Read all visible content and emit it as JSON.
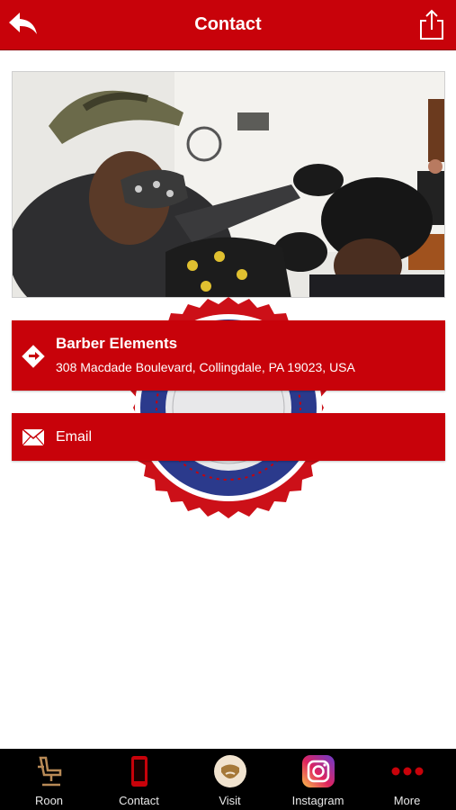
{
  "header": {
    "title": "Contact"
  },
  "location": {
    "name": "Barber Elements",
    "address": "308 Macdade Boulevard, Collingdale, PA 19023, USA"
  },
  "email": {
    "label": "Email"
  },
  "tabs": [
    {
      "label": "Roon",
      "icon": "barber-chair-icon"
    },
    {
      "label": "Contact",
      "icon": "phone-icon"
    },
    {
      "label": "Visit",
      "icon": "bearded-face-icon"
    },
    {
      "label": "Instagram",
      "icon": "instagram-icon"
    },
    {
      "label": "More",
      "icon": "more-dots-icon"
    }
  ],
  "colors": {
    "brand_red": "#c8020a",
    "tab_bar": "#000000"
  }
}
